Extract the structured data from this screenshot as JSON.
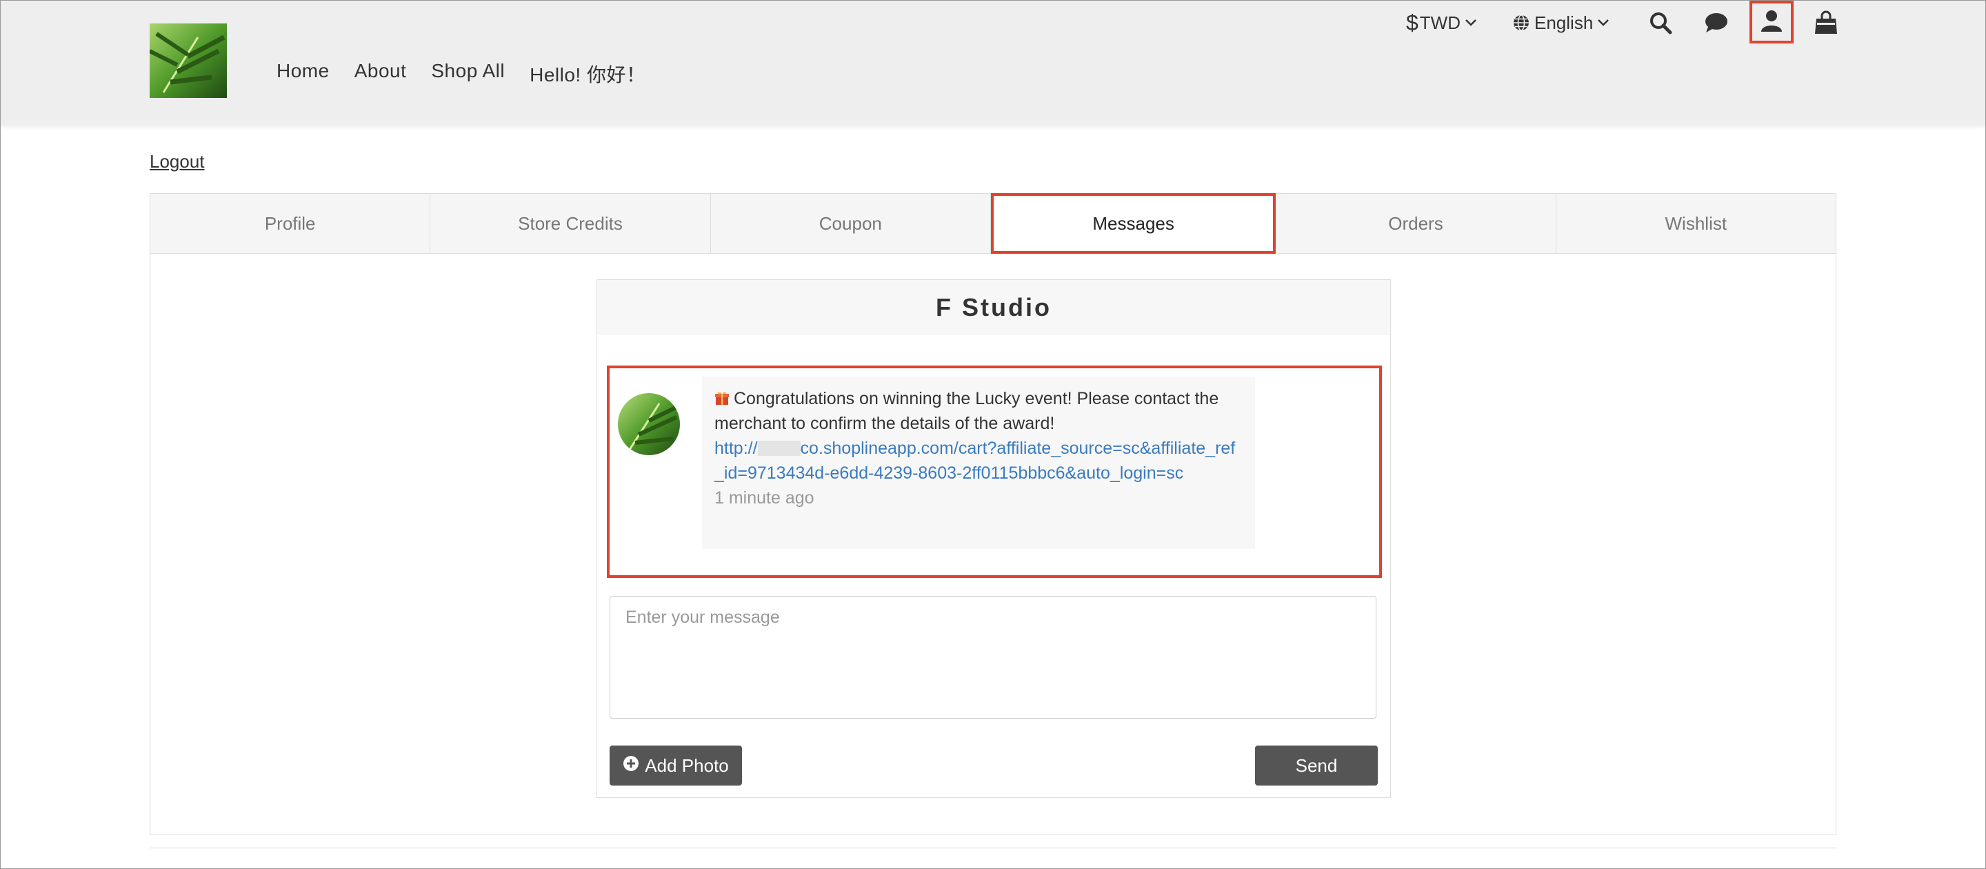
{
  "header": {
    "nav": [
      {
        "label": "Home"
      },
      {
        "label": "About"
      },
      {
        "label": "Shop All"
      },
      {
        "label": "Hello! 你好！"
      }
    ],
    "currency": {
      "symbol": "$",
      "label": "TWD"
    },
    "language": {
      "label": "English"
    },
    "icons": [
      "search-icon",
      "chat-icon",
      "user-icon",
      "shopping-bag-icon"
    ]
  },
  "account": {
    "logout_label": "Logout",
    "tabs": [
      {
        "label": "Profile"
      },
      {
        "label": "Store Credits"
      },
      {
        "label": "Coupon"
      },
      {
        "label": "Messages",
        "active": true
      },
      {
        "label": "Orders"
      },
      {
        "label": "Wishlist"
      }
    ]
  },
  "chat": {
    "title": "F Studio",
    "message": {
      "text": "Congratulations on winning the Lucky  event! Please contact the merchant to confirm the details of the award!",
      "link_prefix": "http://",
      "link_rest": "co.shoplineapp.com/cart?affiliate_source=sc&affiliate_ref_id=9713434d-e6dd-4239-8603-2ff0115bbbc6&auto_login=sc",
      "time": "1 minute ago"
    },
    "input_placeholder": "Enter your message",
    "add_photo_label": "Add Photo",
    "send_label": "Send"
  },
  "colors": {
    "header_bg": "#eeeeee",
    "highlight": "#e0432d",
    "link": "#3a7bbf",
    "button_bg": "#555555"
  }
}
